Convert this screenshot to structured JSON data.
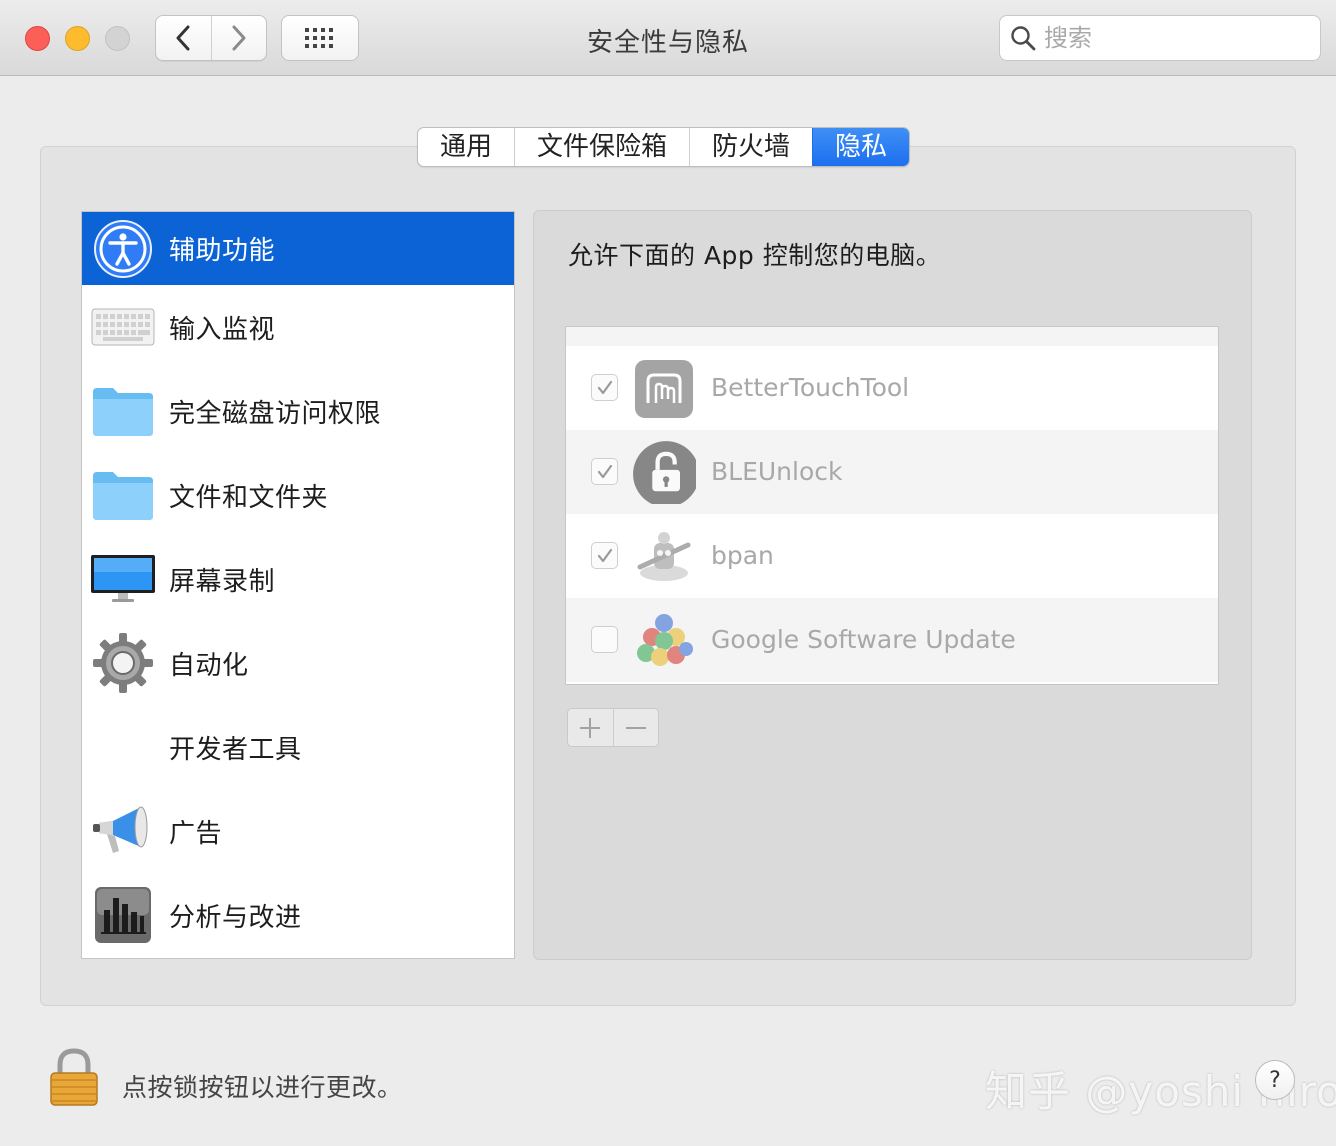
{
  "window": {
    "title": "安全性与隐私",
    "search_placeholder": "搜索"
  },
  "tabs": [
    {
      "label": "通用",
      "active": false
    },
    {
      "label": "文件保险箱",
      "active": false
    },
    {
      "label": "防火墙",
      "active": false
    },
    {
      "label": "隐私",
      "active": true
    }
  ],
  "sidebar": {
    "items": [
      {
        "label": "辅助功能",
        "icon": "accessibility-icon",
        "selected": true
      },
      {
        "label": "输入监视",
        "icon": "keyboard-icon",
        "selected": false
      },
      {
        "label": "完全磁盘访问权限",
        "icon": "folder-icon",
        "selected": false
      },
      {
        "label": "文件和文件夹",
        "icon": "folder-icon",
        "selected": false
      },
      {
        "label": "屏幕录制",
        "icon": "display-icon",
        "selected": false
      },
      {
        "label": "自动化",
        "icon": "gear-icon",
        "selected": false
      },
      {
        "label": "开发者工具",
        "icon": "",
        "selected": false
      },
      {
        "label": "广告",
        "icon": "megaphone-icon",
        "selected": false
      },
      {
        "label": "分析与改进",
        "icon": "chart-icon",
        "selected": false
      }
    ]
  },
  "main": {
    "heading": "允许下面的 App 控制您的电脑。",
    "apps": [
      {
        "name": "BetterTouchTool",
        "checked": true,
        "icon": "bettertouchtool-icon"
      },
      {
        "name": "BLEUnlock",
        "checked": true,
        "icon": "bleunlock-icon"
      },
      {
        "name": "bpan",
        "checked": true,
        "icon": "automator-icon"
      },
      {
        "name": "Google Software Update",
        "checked": false,
        "icon": "google-update-icon"
      }
    ],
    "add_label": "+",
    "remove_label": "−"
  },
  "footer": {
    "lock_text": "点按锁按钮以进行更改。",
    "help_label": "?",
    "watermark": "知乎 @yoshi hiro"
  },
  "colors": {
    "accent": "#0b63d6",
    "tab_active": "#1c6ff0",
    "close": "#fc5f57",
    "minimize": "#fdbc2e",
    "zoom_disabled": "#d3d3d3"
  }
}
